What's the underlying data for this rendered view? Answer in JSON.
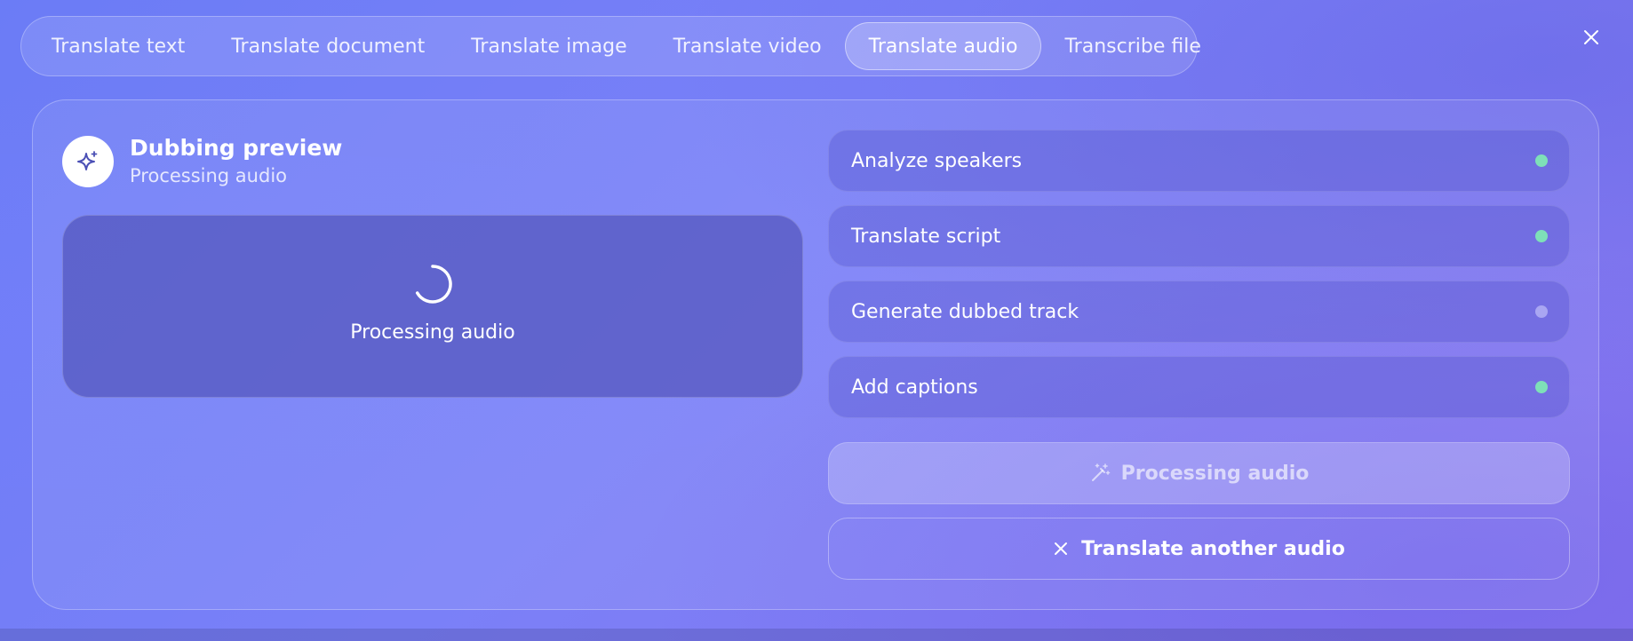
{
  "tabs": [
    {
      "label": "Translate text",
      "active": false
    },
    {
      "label": "Translate document",
      "active": false
    },
    {
      "label": "Translate image",
      "active": false
    },
    {
      "label": "Translate video",
      "active": false
    },
    {
      "label": "Translate audio",
      "active": true
    },
    {
      "label": "Transcribe file",
      "active": false
    }
  ],
  "preview": {
    "title": "Dubbing preview",
    "subtitle": "Processing audio",
    "status_label": "Processing audio",
    "icon": "sparkle-icon"
  },
  "steps": [
    {
      "label": "Analyze speakers",
      "status": "done",
      "color": "#7ee0b8"
    },
    {
      "label": "Translate script",
      "status": "done",
      "color": "#7ee0b8"
    },
    {
      "label": "Generate dubbed track",
      "status": "pending",
      "color": "#a9a6f2"
    },
    {
      "label": "Add captions",
      "status": "done",
      "color": "#7ee0b8"
    }
  ],
  "actions": {
    "processing_label": "Processing audio",
    "another_label": "Translate another audio"
  },
  "colors": {
    "accent": "#6b7cf6",
    "done": "#7ee0b8",
    "pending": "#a9a6f2"
  }
}
